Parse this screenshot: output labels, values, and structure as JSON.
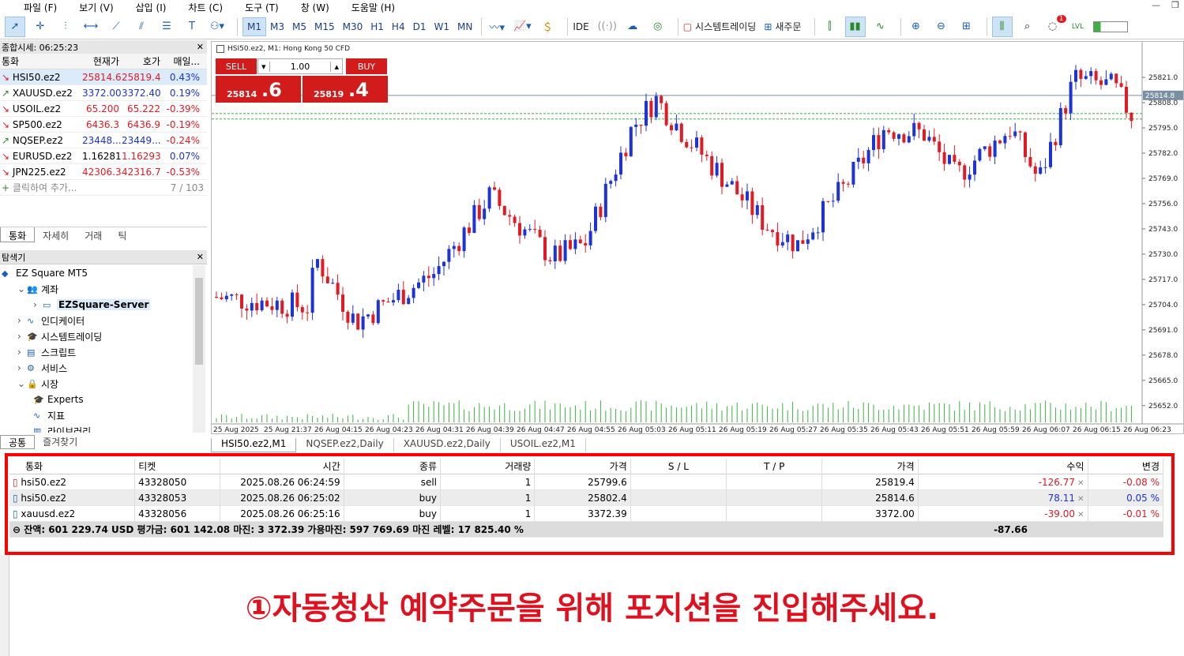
{
  "menu": [
    "파일 (F)",
    "보기 (V)",
    "삽입 (I)",
    "차트 (C)",
    "도구 (T)",
    "창 (W)",
    "도움말 (H)"
  ],
  "toolbar": {
    "timeframes": [
      "M1",
      "M3",
      "M5",
      "M15",
      "M30",
      "H1",
      "H4",
      "D1",
      "W1",
      "MN"
    ],
    "selected_timeframe": "M1",
    "ide": "IDE",
    "algo_trading": "시스템트레이딩",
    "new_order": "새주문",
    "notification_count": "1"
  },
  "market_watch": {
    "title": "종합시세: 06:25:23",
    "columns": [
      "통화",
      "현재가",
      "호가",
      "매일..."
    ],
    "rows": [
      {
        "symbol": "HSI50.ez2",
        "bid": "25814.6",
        "ask": "25819.4",
        "change": "0.43%",
        "dir": "down",
        "bidc": "red",
        "askc": "red",
        "chgc": "blue"
      },
      {
        "symbol": "XAUUSD.ez2",
        "bid": "3372.00",
        "ask": "3372.40",
        "change": "0.19%",
        "dir": "up",
        "bidc": "blue",
        "askc": "blue",
        "chgc": "blue"
      },
      {
        "symbol": "USOIL.ez2",
        "bid": "65.200",
        "ask": "65.222",
        "change": "-0.39%",
        "dir": "down",
        "bidc": "red",
        "askc": "red",
        "chgc": "red"
      },
      {
        "symbol": "SP500.ez2",
        "bid": "6436.3",
        "ask": "6436.9",
        "change": "-0.19%",
        "dir": "down",
        "bidc": "red",
        "askc": "red",
        "chgc": "red"
      },
      {
        "symbol": "NQSEP.ez2",
        "bid": "23448...",
        "ask": "23449...",
        "change": "-0.24%",
        "dir": "up",
        "bidc": "blue",
        "askc": "blue",
        "chgc": "red"
      },
      {
        "symbol": "EURUSD.ez2",
        "bid": "1.16281",
        "ask": "1.16293",
        "change": "0.07%",
        "dir": "down",
        "bidc": "black",
        "askc": "red",
        "chgc": "blue"
      },
      {
        "symbol": "JPN225.ez2",
        "bid": "42306.3",
        "ask": "42316.7",
        "change": "-0.53%",
        "dir": "down",
        "bidc": "red",
        "askc": "red",
        "chgc": "red"
      }
    ],
    "add_row": "클릭하여 추가...",
    "count": "7 / 103",
    "tabs": [
      "통화",
      "자세히",
      "거래",
      "틱"
    ]
  },
  "navigator": {
    "title": "탐색기",
    "items": [
      {
        "label": "EZ Square MT5",
        "indent": 0
      },
      {
        "label": "계좌",
        "indent": 1
      },
      {
        "label": "EZSquare-Server",
        "indent": 2
      },
      {
        "label": "인디케이터",
        "indent": 1
      },
      {
        "label": "시스템트레이딩",
        "indent": 1
      },
      {
        "label": "스크립트",
        "indent": 1
      },
      {
        "label": "서비스",
        "indent": 1
      },
      {
        "label": "시장",
        "indent": 1
      },
      {
        "label": "Experts",
        "indent": 2
      },
      {
        "label": "지표",
        "indent": 2
      },
      {
        "label": "라이브러리",
        "indent": 2
      }
    ],
    "tabs": [
      "공통",
      "즐겨찾기"
    ]
  },
  "chart": {
    "title": "HSI50.ez2, M1:  Hong Kong 50 CFD",
    "sell_label": "SELL",
    "buy_label": "BUY",
    "lot": "1.00",
    "sell_price_main": "25814",
    "sell_price_pips": ".6",
    "buy_price_main": "25819",
    "buy_price_pips": ".4",
    "current_price": "25814.8",
    "price_axis": [
      "25821.0",
      "25808.0",
      "25795.0",
      "25782.0",
      "25769.0",
      "25756.0",
      "25743.0",
      "25730.0",
      "25717.0",
      "25704.0",
      "25691.0",
      "25678.0",
      "25665.0",
      "25652.0"
    ],
    "time_axis": [
      "25 Aug 2025",
      "25 Aug 21:37",
      "26 Aug 04:15",
      "26 Aug 04:23",
      "26 Aug 04:31",
      "26 Aug 04:39",
      "26 Aug 04:47",
      "26 Aug 04:55",
      "26 Aug 05:03",
      "26 Aug 05:11",
      "26 Aug 05:19",
      "26 Aug 05:27",
      "26 Aug 05:35",
      "26 Aug 05:43",
      "26 Aug 05:51",
      "26 Aug 05:59",
      "26 Aug 06:07",
      "26 Aug 06:15",
      "26 Aug 06:23"
    ],
    "tabs": [
      "HSI50.ez2,M1",
      "NQSEP.ez2,Daily",
      "XAUUSD.ez2,Daily",
      "USOIL.ez2,M1"
    ],
    "colors": {
      "up": "#1c33d8",
      "down": "#e01b24",
      "volume": "#3cb043"
    }
  },
  "trade": {
    "columns": [
      "통화",
      "티켓",
      "시간",
      "종류",
      "거래량",
      "가격",
      "S / L",
      "T / P",
      "가격",
      "수익",
      "변경"
    ],
    "rows": [
      {
        "symbol": "hsi50.ez2",
        "ticket": "43328050",
        "time": "2025.08.26 06:24:59",
        "type": "sell",
        "volume": "1",
        "open": "25799.6",
        "sl": "",
        "tp": "",
        "price": "25819.4",
        "profit": "-126.77",
        "change": "-0.08 %",
        "pc": "red"
      },
      {
        "symbol": "hsi50.ez2",
        "ticket": "43328053",
        "time": "2025.08.26 06:25:02",
        "type": "buy",
        "volume": "1",
        "open": "25802.4",
        "sl": "",
        "tp": "",
        "price": "25814.6",
        "profit": "78.11",
        "change": "0.05 %",
        "pc": "blue"
      },
      {
        "symbol": "xauusd.ez2",
        "ticket": "43328056",
        "time": "2025.08.26 06:25:16",
        "type": "buy",
        "volume": "1",
        "open": "3372.39",
        "sl": "",
        "tp": "",
        "price": "3372.00",
        "profit": "-39.00",
        "change": "-0.01 %",
        "pc": "red"
      }
    ],
    "summary": "잔액: 601 229.74 USD  평가금: 601 142.08  마진: 3 372.39  가용마진: 597 769.69  마진 레벨: 17 825.40 %",
    "summary_profit": "-87.66"
  },
  "instruction": "①자동청산 예약주문을 위해 포지션을 진입해주세요."
}
